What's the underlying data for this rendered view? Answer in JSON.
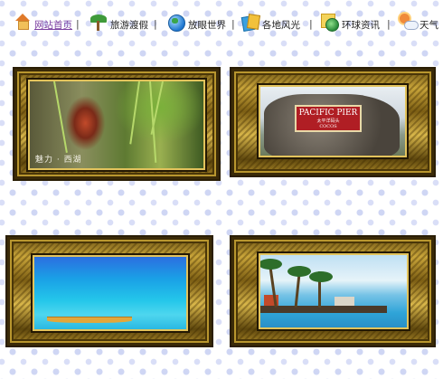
{
  "nav": {
    "items": [
      {
        "label": "网站首页",
        "icon": "house-icon"
      },
      {
        "label": "旅游渡假",
        "icon": "palm-tree-icon"
      },
      {
        "label": "放眼世界",
        "icon": "globe-icon"
      },
      {
        "label": "各地风光",
        "icon": "photos-icon"
      },
      {
        "label": "环球资讯",
        "icon": "earth-news-icon"
      },
      {
        "label": "天气",
        "icon": "weather-icon"
      }
    ],
    "separator": "|"
  },
  "gallery": {
    "photos": [
      {
        "caption": "魅力 · 西湖",
        "subject": "green scenic lantern view"
      },
      {
        "sign_title": "PACIFIC PIER",
        "sign_sub": "太平洋码头",
        "sign_small": "COCOS"
      },
      {
        "subject": "turquoise sea with boat"
      },
      {
        "subject": "tropical pier with palm trees"
      }
    ]
  },
  "colors": {
    "page_background": "#ffffff",
    "dot_pattern": "#cfd6f4",
    "frame_gold": "#c9a53a",
    "home_link": "#7a3ea0"
  }
}
